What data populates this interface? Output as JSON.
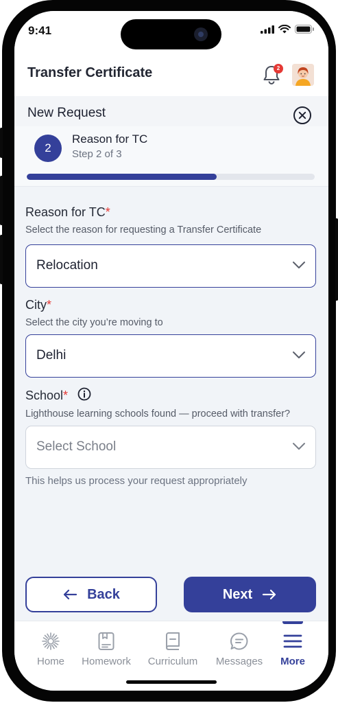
{
  "status_bar": {
    "time": "9:41"
  },
  "header": {
    "title": "Transfer Certificate",
    "notification_count": "2"
  },
  "panel": {
    "title": "New Request"
  },
  "stepper": {
    "number": "2",
    "title": "Reason for TC",
    "subtitle": "Step 2 of 3",
    "progress_fraction": 0.66
  },
  "form": {
    "reason": {
      "label": "Reason for TC",
      "required_mark": "*",
      "help": "Select the reason for requesting a Transfer Certificate",
      "value": "Relocation"
    },
    "city": {
      "label": "City",
      "required_mark": "*",
      "help": "Select the city you’re moving to",
      "value": "Delhi"
    },
    "school": {
      "label": "School",
      "required_mark": "*",
      "help": "Lighthouse learning schools found — proceed with transfer?",
      "placeholder": "Select School",
      "note": "This helps us process your request appropriately"
    }
  },
  "actions": {
    "back_label": "Back",
    "next_label": "Next"
  },
  "tabbar": {
    "items": [
      {
        "label": "Home",
        "icon": "home-icon"
      },
      {
        "label": "Homework",
        "icon": "homework-icon"
      },
      {
        "label": "Curriculum",
        "icon": "curriculum-icon"
      },
      {
        "label": "Messages",
        "icon": "messages-icon"
      },
      {
        "label": "More",
        "icon": "menu-icon",
        "active": true
      }
    ]
  },
  "colors": {
    "primary": "#34409a",
    "required": "#e53935",
    "background": "#f1f4f8"
  }
}
